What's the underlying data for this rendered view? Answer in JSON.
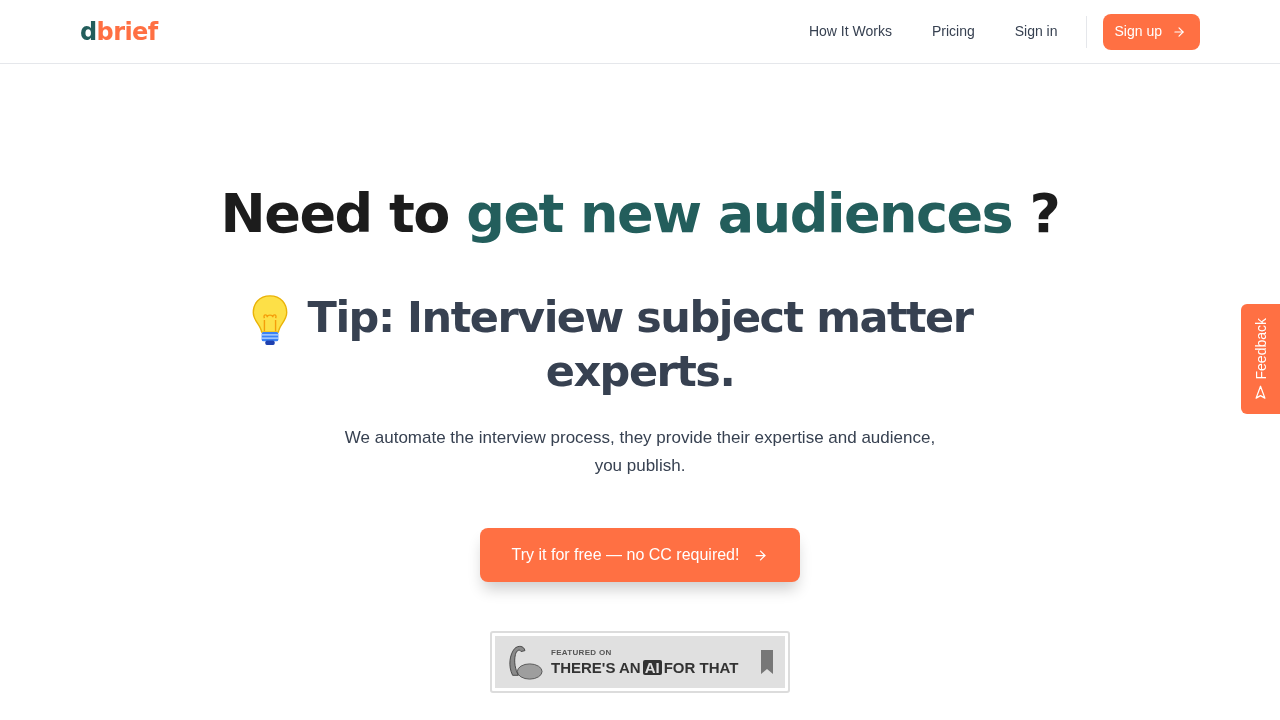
{
  "header": {
    "logo": [
      {
        "text": "d",
        "color": "#235e5c"
      },
      {
        "text": "brief",
        "color": "#ff7043"
      }
    ],
    "nav_links": [
      {
        "label": "How It Works"
      },
      {
        "label": "Pricing"
      },
      {
        "label": "Sign in"
      }
    ],
    "signup_button": {
      "label": "Sign up"
    }
  },
  "hero": {
    "headline": [
      {
        "text": "Need to",
        "highlight": false
      },
      {
        "text": "get new audiences",
        "highlight": true
      },
      {
        "text": "?",
        "highlight": false
      }
    ],
    "tip": "Tip: Interview subject matter experts.",
    "description": "We automate the interview process, they provide their expertise and audience, you publish.",
    "cta_button": {
      "label": "Try it for free — no CC required!"
    },
    "badge": {
      "overline": "FEATURED ON",
      "title_start": "THERE'S AN",
      "title_mark": "AI",
      "title_end": "FOR THAT"
    }
  },
  "feedback_tab": {
    "label": "Feedback"
  }
}
